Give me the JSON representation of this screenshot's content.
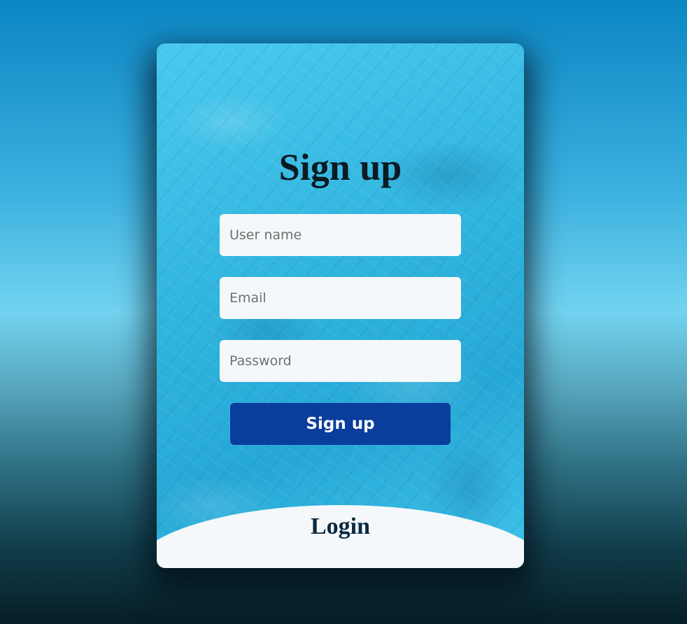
{
  "form": {
    "title": "Sign up",
    "username": {
      "placeholder": "User name",
      "value": ""
    },
    "email": {
      "placeholder": "Email",
      "value": ""
    },
    "password": {
      "placeholder": "Password",
      "value": ""
    },
    "submit_label": "Sign up"
  },
  "footer": {
    "login_label": "Login"
  },
  "colors": {
    "accent": "#0a3d9c",
    "card": "#35bde3",
    "field_bg": "#f5f8fa"
  }
}
